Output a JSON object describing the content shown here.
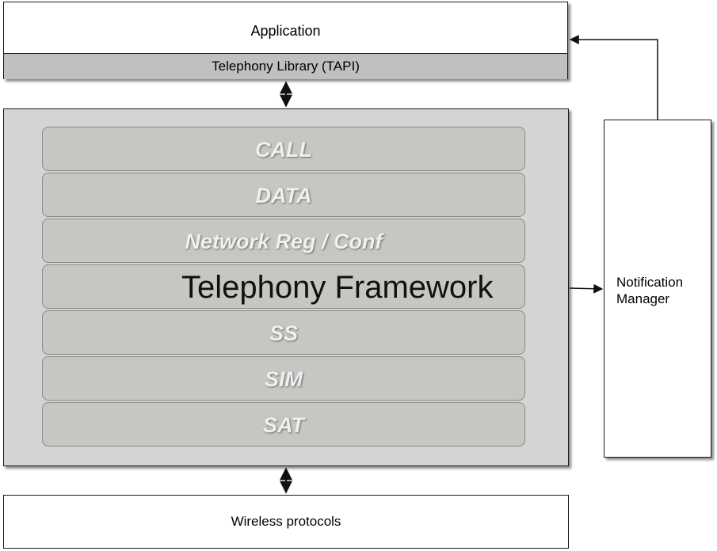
{
  "application": {
    "title": "Application",
    "library": "Telephony Library (TAPI)"
  },
  "framework": {
    "title": "Telephony Framework",
    "modules": [
      "CALL",
      "DATA",
      "Network Reg / Conf",
      "",
      "SS",
      "SIM",
      "SAT"
    ]
  },
  "notification_manager": {
    "line1": "Notification",
    "line2": "Manager"
  },
  "wireless": {
    "title": "Wireless protocols"
  }
}
